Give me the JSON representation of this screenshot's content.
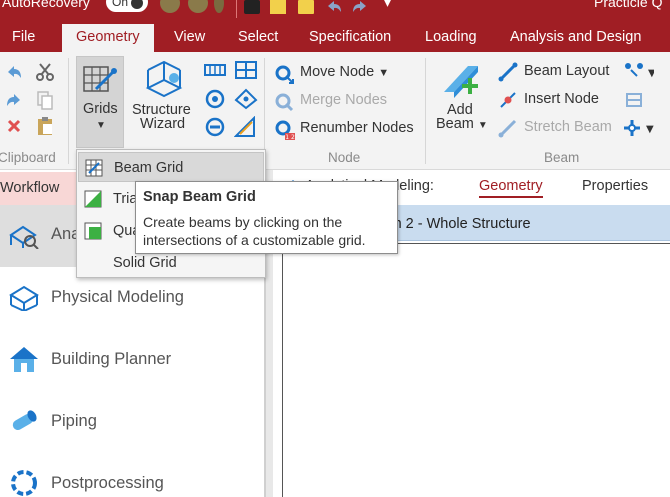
{
  "titlebar": {
    "autorecovery_label": "AutoRecovery",
    "autorecovery_toggle": "On",
    "file_name_partial": "Practicle Q"
  },
  "menu": {
    "tabs": [
      {
        "label": "File"
      },
      {
        "label": "Geometry"
      },
      {
        "label": "View"
      },
      {
        "label": "Select"
      },
      {
        "label": "Specification"
      },
      {
        "label": "Loading"
      },
      {
        "label": "Analysis and Design"
      }
    ],
    "active": "Geometry"
  },
  "ribbon": {
    "clipboard": {
      "label": "Clipboard"
    },
    "grids": {
      "label": "Grids"
    },
    "structure_wizard": {
      "line1": "Structure",
      "line2": "Wizard"
    },
    "node": {
      "label": "Node",
      "move": "Move Node",
      "merge": "Merge Nodes",
      "renumber": "Renumber Nodes"
    },
    "beam": {
      "label": "Beam",
      "add_line1": "Add",
      "add_line2": "Beam",
      "layout": "Beam Layout",
      "insert": "Insert Node",
      "stretch": "Stretch Beam"
    }
  },
  "workflow": {
    "header": "Workflow",
    "items": [
      {
        "label": "Ana"
      },
      {
        "label": "Physical Modeling"
      },
      {
        "label": "Building Planner"
      },
      {
        "label": "Piping"
      },
      {
        "label": "Postprocessing"
      }
    ]
  },
  "grids_menu": {
    "items": [
      {
        "label": "Beam Grid"
      },
      {
        "label": "Tria"
      },
      {
        "label": "Qua"
      },
      {
        "label": "Solid Grid"
      }
    ]
  },
  "tooltip": {
    "title": "Snap Beam Grid",
    "body": "Create beams by clicking on the intersections of a customizable grid."
  },
  "main": {
    "tabs_prefix": "Analytical Modeling:",
    "tab_geometry": "Geometry",
    "tab_properties": "Properties",
    "view_title": "stion 2 - Whole Structure"
  },
  "colors": {
    "brand_red": "#a01e24",
    "ribbon_bg": "#f3f3f3",
    "workflow_highlight": "#f8d7d6",
    "view_header": "#c9dcef",
    "accent_blue": "#1a73c8"
  }
}
